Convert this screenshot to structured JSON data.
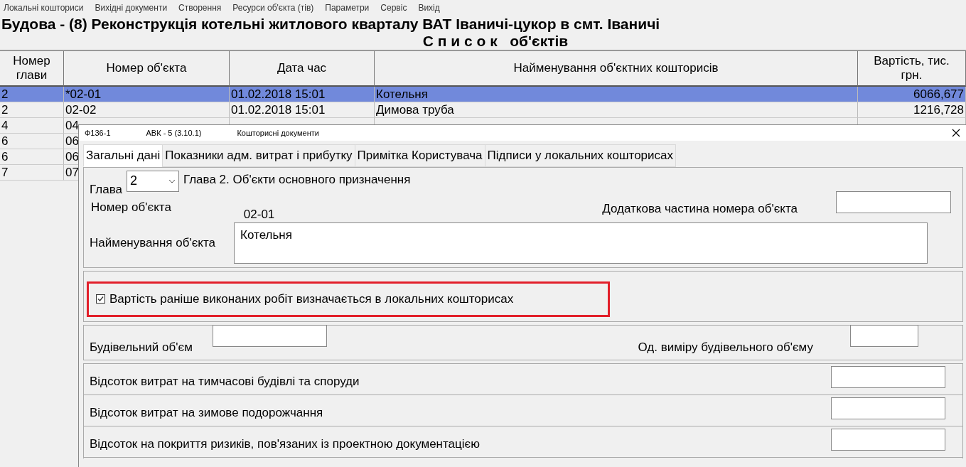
{
  "menu": [
    "Локальні кошториси",
    "Вихідні документи",
    "Створення",
    "Ресурси  об'єкта (тів)",
    "Параметри",
    "Сервіс",
    "Вихід"
  ],
  "title": "Будова - (8) Реконструкція котельні житлового кварталу ВАТ Іваничі-цукор в смт. Іваничі",
  "subtitle": "С п и с о к   об'єктів",
  "table": {
    "columns": [
      "Номер глави",
      "Номер об'єкта",
      "Дата час",
      "Найменування об'єктних кошторисів",
      "Вартість, тис. грн."
    ],
    "rows": [
      {
        "selected": true,
        "cells": [
          "2",
          "*02-01",
          "01.02.2018 15:01",
          "Котельня",
          "6066,677"
        ]
      },
      {
        "selected": false,
        "cells": [
          "2",
          "02-02",
          "01.02.2018 15:01",
          "Димова труба",
          "1216,728"
        ]
      },
      {
        "selected": false,
        "cells": [
          "4",
          "04"
        ]
      },
      {
        "selected": false,
        "cells": [
          "6",
          "06"
        ]
      },
      {
        "selected": false,
        "cells": [
          "6",
          "06"
        ]
      },
      {
        "selected": false,
        "cells": [
          "7",
          "07"
        ]
      }
    ]
  },
  "dialog": {
    "title_parts": [
      "Ф136-1",
      "АВК - 5 (3.10.1)",
      "Кошторисні документи"
    ],
    "tabs": [
      {
        "label": "Загальні дані",
        "selected": true
      },
      {
        "label": "Показники адм. витрат і прибутку",
        "selected": false
      },
      {
        "label": "Примітка Користувача",
        "selected": false
      },
      {
        "label": "Підписи у локальних кошторисах",
        "selected": false
      }
    ],
    "chapter_label": "Глава",
    "chapter_value": "2",
    "chapter_name": "Глава 2. Об'єкти основного призначення",
    "object_number_label": "Номер об'єкта",
    "object_number": "02-01",
    "extra_label": "Додаткова частина номера об'єкта",
    "name_label": "Найменування об'єкта",
    "name_value": "Котельня",
    "checkbox": {
      "label": "Вартість раніше виконаних робіт визначається в локальних кошторисах",
      "checked": true,
      "highlighted": true
    },
    "volume_label": "Будівельний об'єм",
    "unit_label": "Од. виміру будівельного об'єму",
    "percent_rows": [
      {
        "label": "Відсоток витрат на тимчасові будівлі та споруди"
      },
      {
        "label": "Відсоток витрат на зимове подорожчання"
      },
      {
        "label": "Відсоток на покриття ризиків, пов'язаних із проектною документацією"
      }
    ]
  }
}
